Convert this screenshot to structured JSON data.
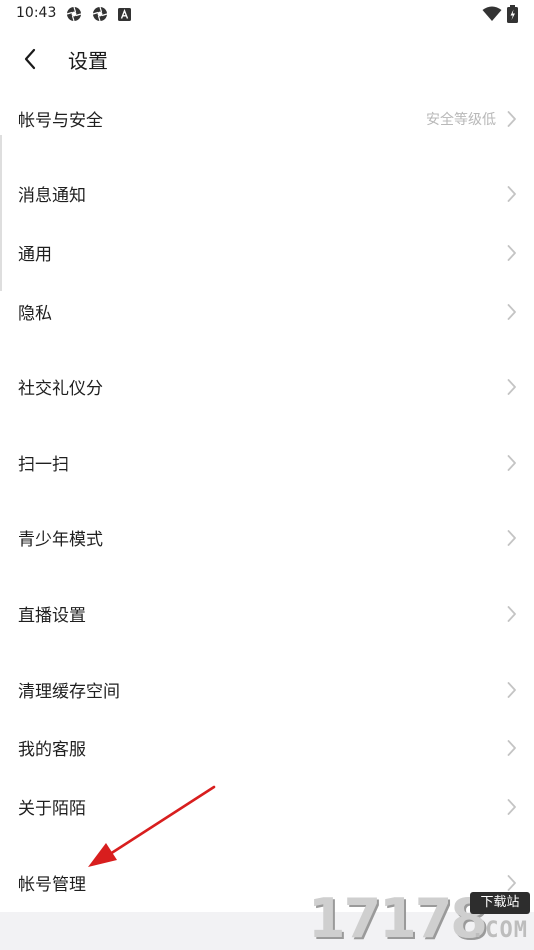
{
  "status_bar": {
    "time": "10:43",
    "icons": [
      "aperture-icon",
      "aperture-icon",
      "notification-a-icon",
      "wifi-icon",
      "battery-charging-icon"
    ]
  },
  "header": {
    "title": "设置",
    "back_icon": "chevron-left-icon"
  },
  "menu": {
    "items": [
      {
        "label": "帐号与安全",
        "value": "安全等级低"
      },
      {
        "label": "消息通知"
      },
      {
        "label": "通用"
      },
      {
        "label": "隐私"
      },
      {
        "label": "社交礼仪分"
      },
      {
        "label": "扫一扫"
      },
      {
        "label": "青少年模式"
      },
      {
        "label": "直播设置"
      },
      {
        "label": "清理缓存空间"
      },
      {
        "label": "我的客服"
      },
      {
        "label": "关于陌陌"
      },
      {
        "label": "帐号管理"
      }
    ]
  },
  "watermark": {
    "digits": "17178",
    "badge": "下载站",
    "domain": ".COM"
  },
  "colors": {
    "annotation_arrow": "#d81e1e",
    "secondary_text": "#b8b8b8",
    "chevron": "#c4c4c4"
  }
}
